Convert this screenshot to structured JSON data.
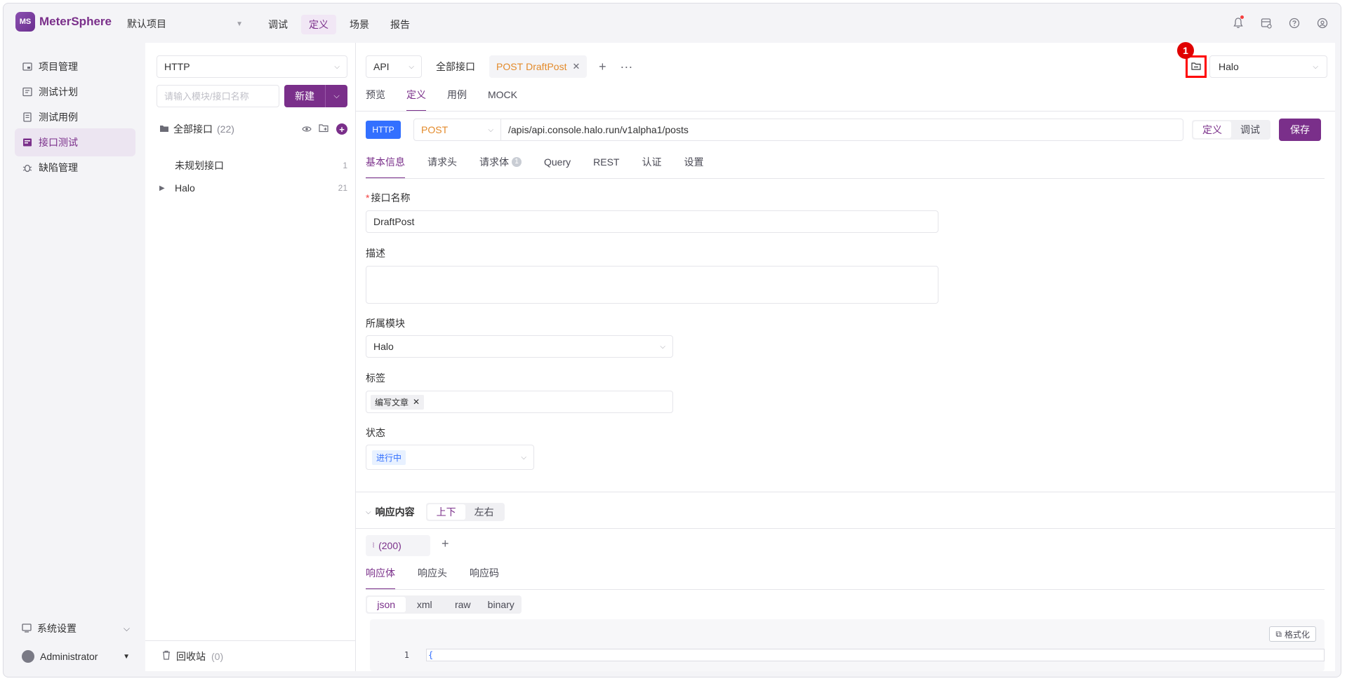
{
  "app": {
    "name": "MeterSphere",
    "logo_text": "MS"
  },
  "header": {
    "project": "默认项目",
    "nav": [
      "调试",
      "定义",
      "场景",
      "报告"
    ],
    "active_nav": "定义"
  },
  "sidebar": {
    "items": [
      {
        "label": "项目管理",
        "icon": "project-icon"
      },
      {
        "label": "测试计划",
        "icon": "test-plan-icon"
      },
      {
        "label": "测试用例",
        "icon": "test-case-icon"
      },
      {
        "label": "接口测试",
        "icon": "api-test-icon"
      },
      {
        "label": "缺陷管理",
        "icon": "bug-icon"
      }
    ],
    "active": "接口测试",
    "system_settings": "系统设置",
    "user": "Administrator"
  },
  "tree": {
    "protocol": "HTTP",
    "search_placeholder": "请输入模块/接口名称",
    "new_label": "新建",
    "all_label": "全部接口",
    "all_count": "(22)",
    "nodes": [
      {
        "label": "未规划接口",
        "count": "1"
      },
      {
        "label": "Halo",
        "count": "21"
      }
    ],
    "recycle_label": "回收站",
    "recycle_count": "(0)"
  },
  "main": {
    "api_type": "API",
    "tabs": [
      {
        "label": "全部接口"
      },
      {
        "method": "POST",
        "label": "DraftPost"
      }
    ],
    "environment": "Halo",
    "callout_number": "1",
    "sub_tabs": [
      "预览",
      "定义",
      "用例",
      "MOCK"
    ],
    "active_sub_tab": "定义",
    "protocol_tag": "HTTP",
    "method": "POST",
    "url": "/apis/api.console.halo.run/v1alpha1/posts",
    "mode_options": [
      "定义",
      "调试"
    ],
    "active_mode": "定义",
    "save_label": "保存",
    "request_tabs": [
      "基本信息",
      "请求头",
      "请求体",
      "Query",
      "REST",
      "认证",
      "设置"
    ],
    "body_count": "1",
    "active_request_tab": "基本信息",
    "form": {
      "name_label": "接口名称",
      "name_value": "DraftPost",
      "desc_label": "描述",
      "desc_value": "",
      "module_label": "所属模块",
      "module_value": "Halo",
      "tags_label": "标签",
      "tag_value": "编写文章",
      "status_label": "状态",
      "status_value": "进行中"
    },
    "response": {
      "title": "响应内容",
      "layout_options": [
        "上下",
        "左右"
      ],
      "active_layout": "上下",
      "code_tab": "(200)",
      "tabs": [
        "响应体",
        "响应头",
        "响应码"
      ],
      "active_tab": "响应体",
      "formats": [
        "json",
        "xml",
        "raw",
        "binary"
      ],
      "active_format": "json",
      "format_button": "格式化",
      "line_number": "1",
      "code_line": "{"
    }
  }
}
